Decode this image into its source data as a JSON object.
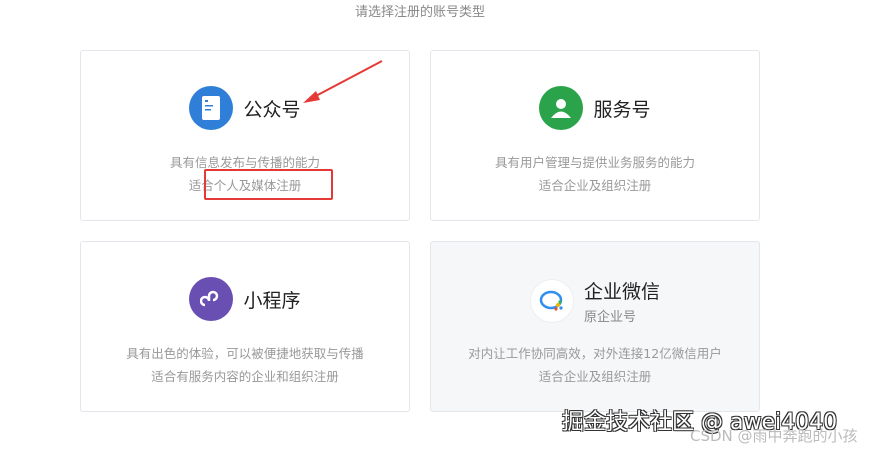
{
  "subtitle": "请选择注册的账号类型",
  "cards": [
    {
      "title": "公众号",
      "desc1": "具有信息发布与传播的能力",
      "desc2": "适合个人及媒体注册",
      "icon": "document-icon",
      "color": "#2f7fd8"
    },
    {
      "title": "服务号",
      "desc1": "具有用户管理与提供业务服务的能力",
      "desc2": "适合企业及组织注册",
      "icon": "user-icon",
      "color": "#2aa34a"
    },
    {
      "title": "小程序",
      "desc1": "具有出色的体验，可以被便捷地获取与传播",
      "desc2": "适合有服务内容的企业和组织注册",
      "icon": "link-icon",
      "color": "#6a4fb3"
    },
    {
      "title": "企业微信",
      "subtitle": "原企业号",
      "desc1": "对内让工作协同高效，对外连接12亿微信用户",
      "desc2": "适合企业及组织注册",
      "icon": "wecom-icon",
      "color": "#ffffff"
    }
  ],
  "watermark": "掘金技术社区 @ awei4040",
  "watermark2": "CSDN @雨中奔跑的小孩"
}
